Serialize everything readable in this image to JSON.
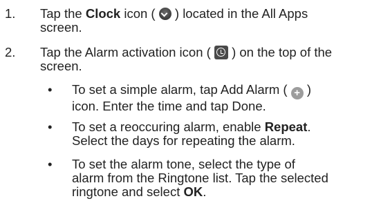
{
  "steps": [
    {
      "number": "1.",
      "pre": "Tap the ",
      "bold": "Clock",
      "icon_lead": " icon ( ",
      "icon": "clock-icon",
      "icon_trail": " ) located in the All Apps",
      "line2": "screen."
    },
    {
      "number": "2.",
      "pre": "Tap the Alarm activation icon ( ",
      "icon": "alarm-clock-icon",
      "icon_trail": " ) on the top of the",
      "line2": "screen."
    }
  ],
  "bullets": [
    {
      "symbol": "•",
      "line1_pre": "To set a simple alarm, tap Add Alarm ( ",
      "icon": "add-icon",
      "icon_glyph": "+",
      "line1_post": " )",
      "line2": "icon. Enter the time and tap Done."
    },
    {
      "symbol": "•",
      "line1_pre": "To set a reoccuring alarm, enable ",
      "line1_bold": "Repeat",
      "line1_post": ".",
      "line2": "Select the days for repeating the alarm."
    },
    {
      "symbol": "•",
      "line1": "To set the alarm tone, select the type of",
      "line2": "alarm from the Ringtone list. Tap the selected",
      "line3_pre": "ringtone and select ",
      "line3_bold": "OK",
      "line3_post": "."
    }
  ]
}
